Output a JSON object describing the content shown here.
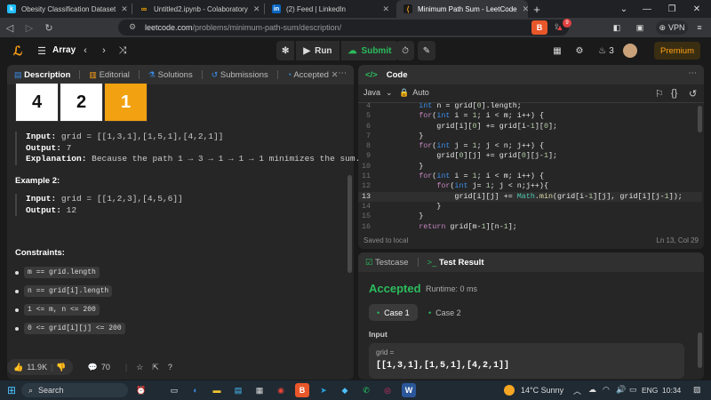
{
  "browser": {
    "tabs": [
      {
        "title": "Obesity Classification Dataset",
        "icon": "kaggle-icon"
      },
      {
        "title": "Untitled2.ipynb - Colaboratory",
        "icon": "colab-icon"
      },
      {
        "title": "(2) Feed | LinkedIn",
        "icon": "linkedin-icon"
      },
      {
        "title": "Minimum Path Sum - LeetCode",
        "icon": "leetcode-icon"
      }
    ],
    "url_host": "leetcode.com",
    "url_path": "/problems/minimum-path-sum/description/",
    "vpn_label": "VPN",
    "badge_count": "9"
  },
  "lc_nav": {
    "problem_list": "Array",
    "run_label": "Run",
    "submit_label": "Submit",
    "streak": "3",
    "premium_label": "Premium"
  },
  "desc": {
    "tabs": [
      "Description",
      "Editorial",
      "Solutions",
      "Submissions",
      "Accepted"
    ],
    "grid_cells": [
      "4",
      "2",
      "1"
    ],
    "example1": {
      "input_label": "Input:",
      "input": "grid = [[1,3,1],[1,5,1],[4,2,1]]",
      "output_label": "Output:",
      "output": "7",
      "explanation_label": "Explanation:",
      "explanation": "Because the path 1 → 3 → 1 → 1 → 1 minimizes the sum."
    },
    "example2_title": "Example 2:",
    "example2": {
      "input_label": "Input:",
      "input": "grid = [[1,2,3],[4,5,6]]",
      "output_label": "Output:",
      "output": "12"
    },
    "constraints_title": "Constraints:",
    "constraints": [
      "m == grid.length",
      "n == grid[i].length",
      "1 <= m, n <= 200",
      "0 <= grid[i][j] <= 200"
    ],
    "likes": "11.9K",
    "comments": "70"
  },
  "code": {
    "title": "Code",
    "language": "Java",
    "mode": "Auto",
    "line_numbers": [
      "4",
      "5",
      "6",
      "7",
      "8",
      "9",
      "10",
      "11",
      "12",
      "13",
      "14",
      "15",
      "16"
    ],
    "current_line": "13",
    "saved": "Saved to local",
    "cursor": "Ln 13, Col 29"
  },
  "result": {
    "tab_testcase": "Testcase",
    "tab_result": "Test Result",
    "status": "Accepted",
    "runtime": "Runtime: 0 ms",
    "cases": [
      "Case 1",
      "Case 2"
    ],
    "input_label": "Input",
    "var_name": "grid =",
    "var_value": "[[1,3,1],[1,5,1],[4,2,1]]"
  },
  "taskbar": {
    "search": "Search",
    "weather": "14°C  Sunny",
    "lang": "ENG",
    "time": "10:34"
  },
  "colors": {
    "accent": "#ffa116",
    "green": "#2cbb5d",
    "blue_kw": "#3b8eea"
  }
}
